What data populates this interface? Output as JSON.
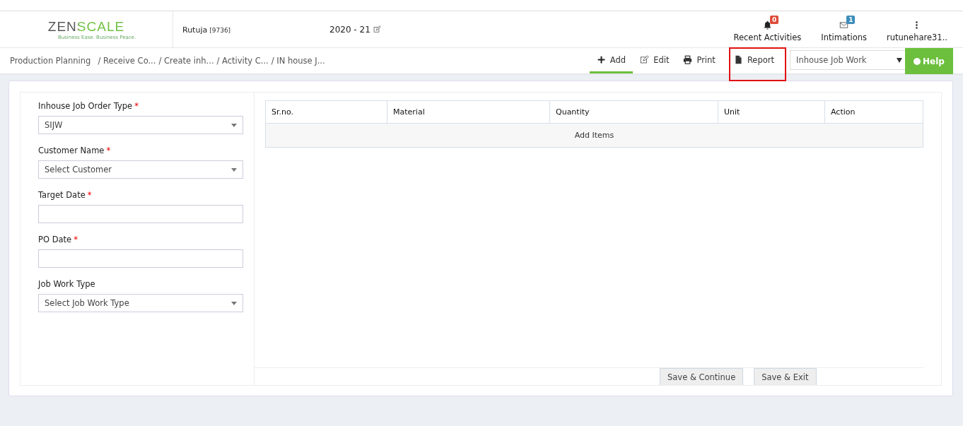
{
  "header": {
    "logo": "ZENSCALE",
    "tagline": "Business Ease. Business Peace.",
    "user": "Rutuja",
    "user_code": "[9736]",
    "year": "2020 - 21",
    "nav": [
      {
        "kind": "bell",
        "label": "Recent Activities",
        "badge": "0",
        "color": "#dd4b39"
      },
      {
        "kind": "mail",
        "label": "Intimations",
        "badge": "1",
        "color": "#3c8dbc"
      },
      {
        "kind": "menu",
        "label": "rutunehare31.."
      }
    ]
  },
  "breadcrumb": [
    "Production Planning",
    "/ Receive Co...",
    "/ Create inh...",
    "/ Activity C...",
    "/ IN house J..."
  ],
  "toolbar": {
    "actions": [
      {
        "kind": "plus",
        "label": "Add",
        "selected": true,
        "highlighted": false
      },
      {
        "kind": "edit",
        "label": "Edit",
        "selected": false,
        "highlighted": false
      },
      {
        "kind": "print",
        "label": "Print",
        "selected": false,
        "highlighted": false
      },
      {
        "kind": "file",
        "label": "Report",
        "selected": false,
        "highlighted": true
      }
    ],
    "module_select": "Inhouse Job Work",
    "help": "Help"
  },
  "form": {
    "fields": [
      {
        "kind": "select",
        "label": "Inhouse Job Order Type",
        "required_mark": "*",
        "value": "SIJW"
      },
      {
        "kind": "select",
        "label": "Customer Name",
        "required_mark": "*",
        "value": "Select Customer"
      },
      {
        "kind": "input",
        "label": "Target Date",
        "required_mark": "*"
      },
      {
        "kind": "input",
        "label": "PO Date",
        "required_mark": "*"
      },
      {
        "kind": "select",
        "label": "Job Work Type",
        "value": "Select Job Work Type"
      }
    ]
  },
  "table": {
    "columns": [
      "Sr.no.",
      "Material",
      "Quantity",
      "Unit",
      "Action"
    ],
    "add_row": "Add Items"
  },
  "buttons": [
    "Save & Continue",
    "Save & Exit"
  ]
}
